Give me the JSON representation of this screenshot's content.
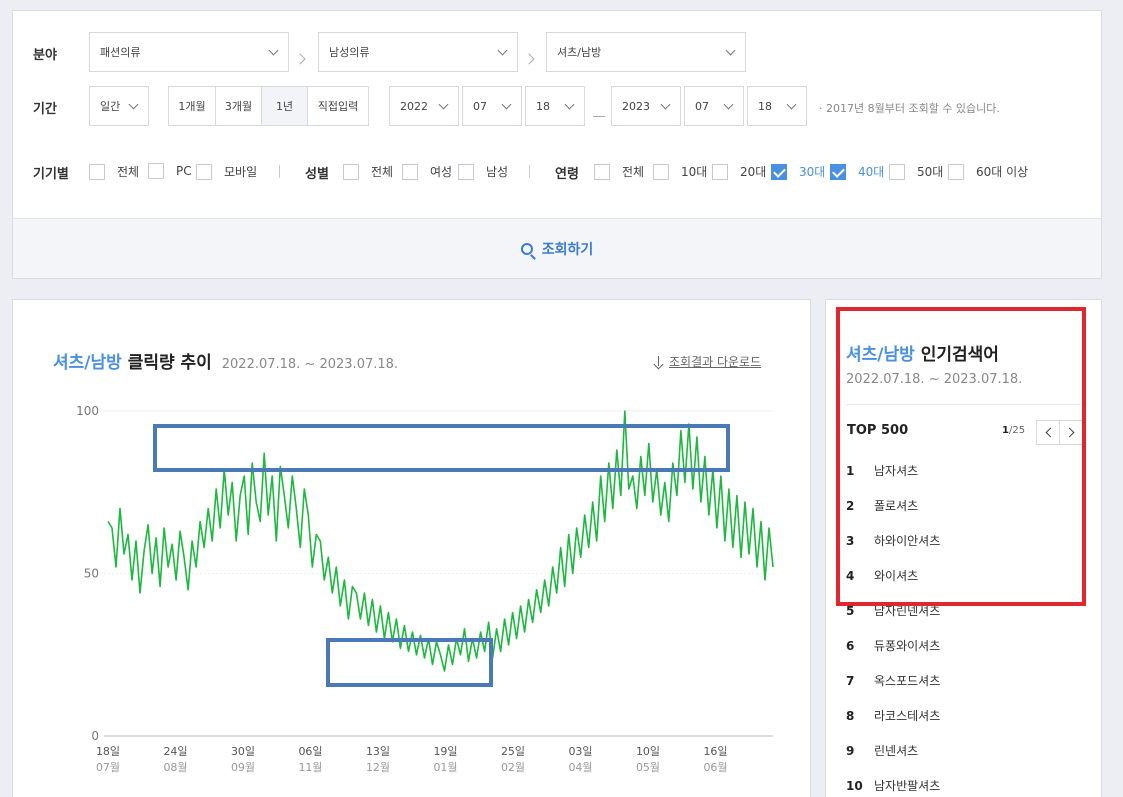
{
  "filters": {
    "category_label": "분야",
    "categories": [
      "패션의류",
      "남성의류",
      "셔츠/남방"
    ],
    "period_label": "기간",
    "period_unit": "일간",
    "period_tabs": [
      {
        "label": "1개월",
        "active": false
      },
      {
        "label": "3개월",
        "active": false
      },
      {
        "label": "1년",
        "active": true
      },
      {
        "label": "직접입력",
        "active": false
      }
    ],
    "start": {
      "year": "2022",
      "month": "07",
      "day": "18"
    },
    "end": {
      "year": "2023",
      "month": "07",
      "day": "18"
    },
    "note": "· 2017년 8월부터 조회할 수 있습니다.",
    "device": {
      "label": "기기별",
      "options": [
        {
          "label": "전체",
          "checked": false
        },
        {
          "label": "PC",
          "checked": false
        },
        {
          "label": "모바일",
          "checked": false
        }
      ]
    },
    "gender": {
      "label": "성별",
      "options": [
        {
          "label": "전체",
          "checked": false
        },
        {
          "label": "여성",
          "checked": false
        },
        {
          "label": "남성",
          "checked": false
        }
      ]
    },
    "age": {
      "label": "연령",
      "options": [
        {
          "label": "전체",
          "checked": false
        },
        {
          "label": "10대",
          "checked": false
        },
        {
          "label": "20대",
          "checked": false
        },
        {
          "label": "30대",
          "checked": true
        },
        {
          "label": "40대",
          "checked": true
        },
        {
          "label": "50대",
          "checked": false
        },
        {
          "label": "60대 이상",
          "checked": false
        }
      ]
    },
    "search_label": "조회하기"
  },
  "trend": {
    "title_accent": "셔츠/남방",
    "title_rest": "클릭량 추이",
    "period": "2022.07.18. ~ 2023.07.18.",
    "download_label": "조회결과 다운로드"
  },
  "keywords": {
    "title_accent": "셔츠/남방",
    "title_rest": "인기검색어",
    "period": "2022.07.18. ~ 2023.07.18.",
    "top_label": "TOP 500",
    "page_current": "1",
    "page_total": "/25",
    "items": [
      {
        "rank": "1",
        "label": "남자셔츠"
      },
      {
        "rank": "2",
        "label": "폴로셔츠"
      },
      {
        "rank": "3",
        "label": "하와이안셔츠"
      },
      {
        "rank": "4",
        "label": "와이셔츠"
      },
      {
        "rank": "5",
        "label": "남자린넨셔츠"
      },
      {
        "rank": "6",
        "label": "듀퐁와이셔츠"
      },
      {
        "rank": "7",
        "label": "옥스포드셔츠"
      },
      {
        "rank": "8",
        "label": "라코스테셔츠"
      },
      {
        "rank": "9",
        "label": "린넨셔츠"
      },
      {
        "rank": "10",
        "label": "남자반팔셔츠"
      }
    ]
  },
  "colors": {
    "accent": "#4a90e2",
    "line": "#1db83f",
    "annotation_blue": "#4a7ab5",
    "annotation_red": "#e0262e"
  },
  "chart_data": {
    "type": "line",
    "ylim": [
      0,
      100
    ],
    "yticks": [
      "100",
      "50",
      "0"
    ],
    "x_ticks": [
      {
        "day": "18일",
        "month": "07월"
      },
      {
        "day": "24일",
        "month": "08월"
      },
      {
        "day": "30일",
        "month": "09월"
      },
      {
        "day": "06일",
        "month": "11월"
      },
      {
        "day": "13일",
        "month": "12월"
      },
      {
        "day": "19일",
        "month": "01월"
      },
      {
        "day": "25일",
        "month": "02월"
      },
      {
        "day": "03일",
        "month": "04월"
      },
      {
        "day": "10일",
        "month": "05월"
      },
      {
        "day": "16일",
        "month": "06월"
      }
    ],
    "series": [
      {
        "values": [
          66,
          64,
          52,
          70,
          56,
          62,
          48,
          60,
          44,
          57,
          65,
          50,
          61,
          46,
          64,
          52,
          59,
          48,
          63,
          55,
          45,
          60,
          52,
          66,
          58,
          70,
          60,
          76,
          64,
          82,
          68,
          78,
          60,
          74,
          80,
          62,
          84,
          72,
          66,
          87,
          68,
          80,
          60,
          83,
          74,
          64,
          80,
          70,
          58,
          76,
          68,
          52,
          62,
          60,
          48,
          55,
          44,
          52,
          40,
          48,
          36,
          46,
          44,
          36,
          44,
          34,
          42,
          32,
          40,
          30,
          38,
          29,
          36,
          27,
          34,
          26,
          32,
          25,
          31,
          24,
          30,
          22,
          29,
          25,
          20,
          28,
          22,
          30,
          25,
          33,
          23,
          30,
          24,
          32,
          26,
          35,
          24,
          33,
          26,
          36,
          28,
          38,
          30,
          40,
          32,
          42,
          35,
          45,
          38,
          48,
          40,
          52,
          44,
          58,
          46,
          62,
          50,
          64,
          55,
          68,
          58,
          72,
          60,
          80,
          66,
          84,
          70,
          88,
          74,
          100,
          76,
          80,
          70,
          86,
          74,
          90,
          72,
          82,
          68,
          78,
          66,
          84,
          74,
          94,
          78,
          96,
          76,
          92,
          72,
          86,
          68,
          82,
          64,
          80,
          60,
          76,
          58,
          74,
          55,
          72,
          56,
          70,
          52,
          66,
          48,
          64,
          52
        ]
      }
    ]
  }
}
